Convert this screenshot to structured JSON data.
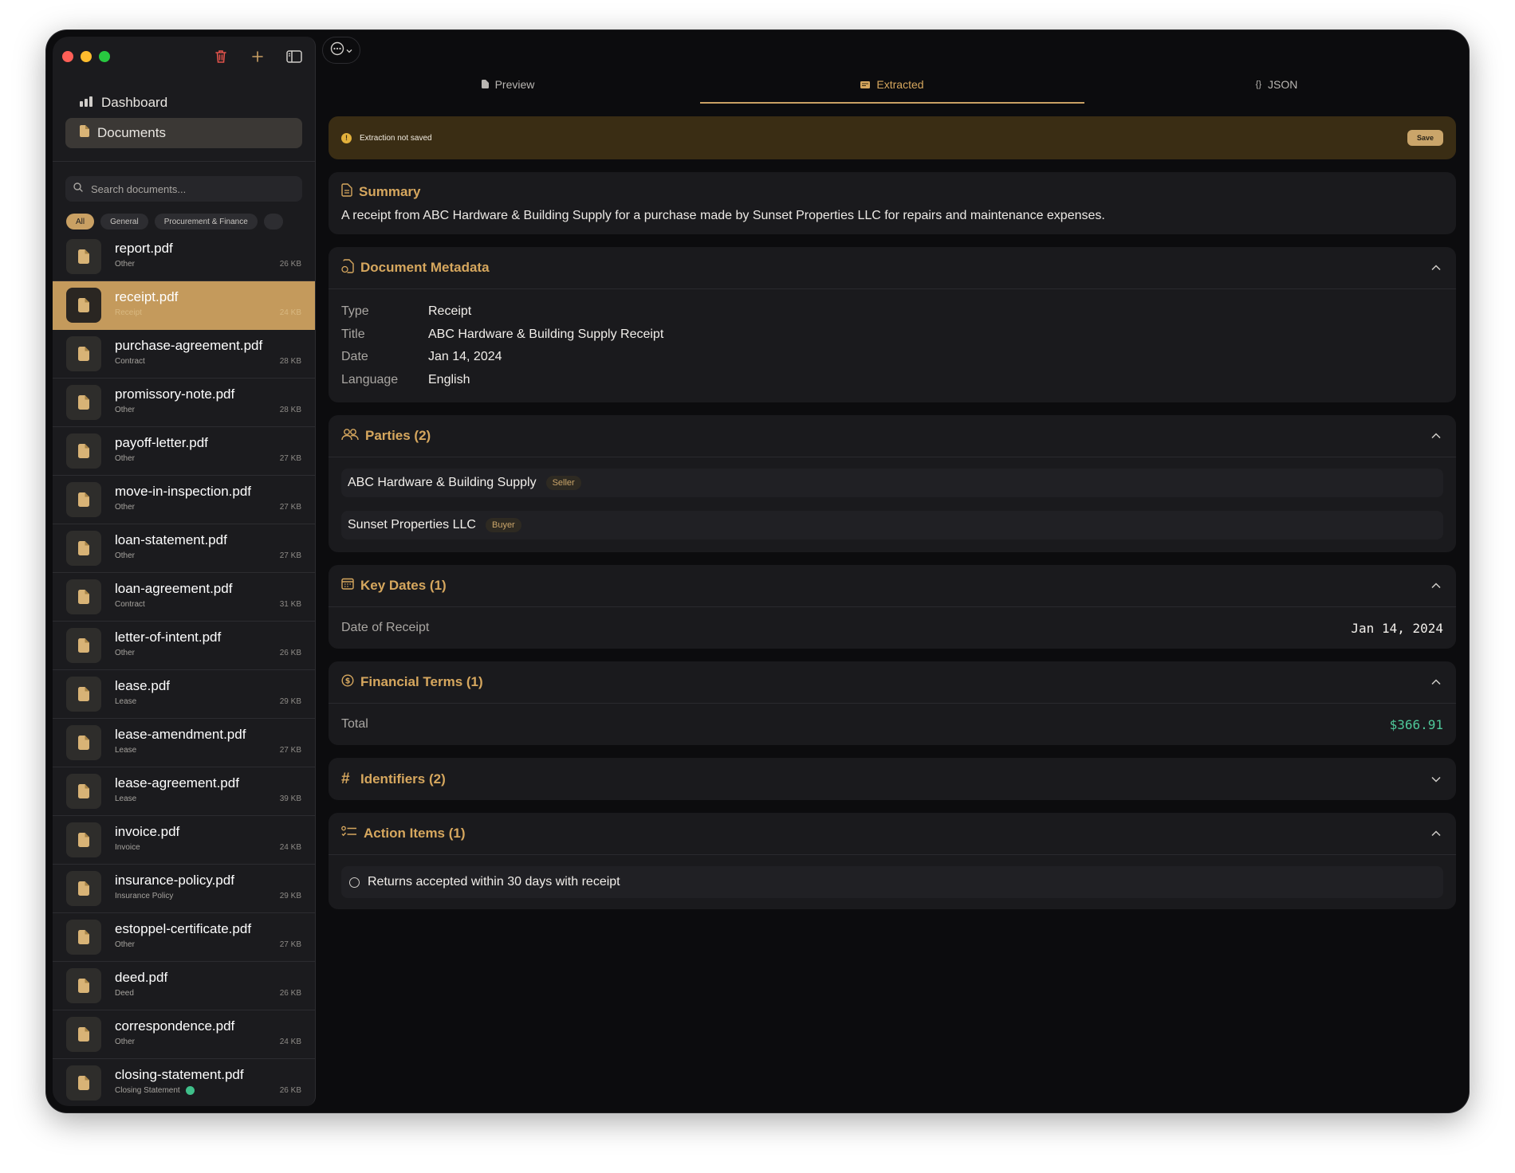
{
  "colors": {
    "accent": "#c9a063",
    "success": "#4fc89a",
    "banner_bg": "#3a2d14"
  },
  "sidebar": {
    "nav": [
      {
        "label": "Dashboard",
        "icon": "bar-chart-icon"
      },
      {
        "label": "Documents",
        "icon": "document-icon"
      }
    ],
    "search_placeholder": "Search documents...",
    "filters": [
      "All",
      "General",
      "Procurement & Finance"
    ],
    "documents": [
      {
        "name": "report.pdf",
        "type": "Other",
        "size": "26 KB"
      },
      {
        "name": "receipt.pdf",
        "type": "Receipt",
        "size": "24 KB"
      },
      {
        "name": "purchase-agreement.pdf",
        "type": "Contract",
        "size": "28 KB"
      },
      {
        "name": "promissory-note.pdf",
        "type": "Other",
        "size": "28 KB"
      },
      {
        "name": "payoff-letter.pdf",
        "type": "Other",
        "size": "27 KB"
      },
      {
        "name": "move-in-inspection.pdf",
        "type": "Other",
        "size": "27 KB"
      },
      {
        "name": "loan-statement.pdf",
        "type": "Other",
        "size": "27 KB"
      },
      {
        "name": "loan-agreement.pdf",
        "type": "Contract",
        "size": "31 KB"
      },
      {
        "name": "letter-of-intent.pdf",
        "type": "Other",
        "size": "26 KB"
      },
      {
        "name": "lease.pdf",
        "type": "Lease",
        "size": "29 KB"
      },
      {
        "name": "lease-amendment.pdf",
        "type": "Lease",
        "size": "27 KB"
      },
      {
        "name": "lease-agreement.pdf",
        "type": "Lease",
        "size": "39 KB"
      },
      {
        "name": "invoice.pdf",
        "type": "Invoice",
        "size": "24 KB"
      },
      {
        "name": "insurance-policy.pdf",
        "type": "Insurance Policy",
        "size": "29 KB"
      },
      {
        "name": "estoppel-certificate.pdf",
        "type": "Other",
        "size": "27 KB"
      },
      {
        "name": "deed.pdf",
        "type": "Deed",
        "size": "26 KB"
      },
      {
        "name": "correspondence.pdf",
        "type": "Other",
        "size": "24 KB"
      },
      {
        "name": "closing-statement.pdf",
        "type": "Closing Statement",
        "size": "26 KB"
      }
    ]
  },
  "tabs": [
    {
      "label": "Preview",
      "icon": "file-icon"
    },
    {
      "label": "Extracted",
      "icon": "card-icon"
    },
    {
      "label": "JSON",
      "icon": "braces-icon"
    }
  ],
  "banner": {
    "text": "Extraction not saved",
    "save_label": "Save"
  },
  "summary": {
    "title": "Summary",
    "text": "A receipt from ABC Hardware & Building Supply for a purchase made by Sunset Properties LLC for repairs and maintenance expenses."
  },
  "metadata": {
    "title": "Document Metadata",
    "rows": [
      {
        "label": "Type",
        "value": "Receipt"
      },
      {
        "label": "Title",
        "value": "ABC Hardware & Building Supply Receipt"
      },
      {
        "label": "Date",
        "value": "Jan 14, 2024"
      },
      {
        "label": "Language",
        "value": "English"
      }
    ]
  },
  "parties": {
    "title": "Parties (2)",
    "items": [
      {
        "name": "ABC Hardware & Building Supply",
        "role": "Seller"
      },
      {
        "name": "Sunset Properties LLC",
        "role": "Buyer"
      }
    ]
  },
  "key_dates": {
    "title": "Key Dates (1)",
    "label": "Date of Receipt",
    "value": "Jan 14, 2024"
  },
  "financial": {
    "title": "Financial Terms (1)",
    "label": "Total",
    "value": "$366.91"
  },
  "identifiers": {
    "title": "Identifiers (2)"
  },
  "actions": {
    "title": "Action Items (1)",
    "items": [
      "Returns accepted within 30 days with receipt"
    ]
  }
}
